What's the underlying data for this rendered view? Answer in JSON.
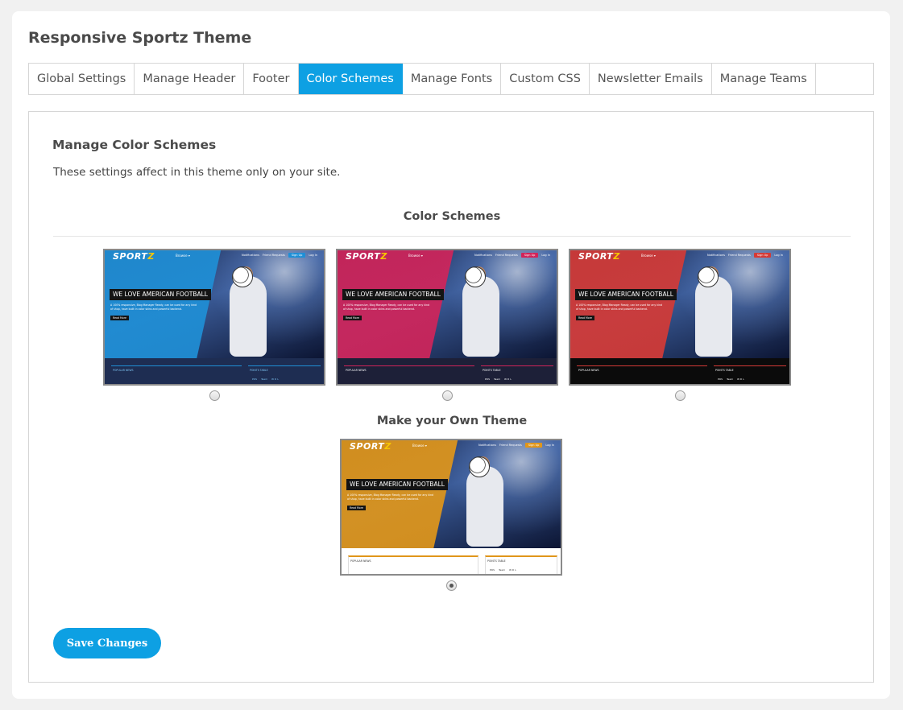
{
  "page": {
    "title": "Responsive Sportz Theme"
  },
  "tabs": [
    {
      "label": "Global Settings",
      "active": false
    },
    {
      "label": "Manage Header",
      "active": false
    },
    {
      "label": "Footer",
      "active": false
    },
    {
      "label": "Color Schemes",
      "active": true
    },
    {
      "label": "Manage Fonts",
      "active": false
    },
    {
      "label": "Custom CSS",
      "active": false
    },
    {
      "label": "Newsletter Emails",
      "active": false
    },
    {
      "label": "Manage Teams",
      "active": false
    }
  ],
  "section": {
    "title": "Manage Color Schemes",
    "description": "These settings affect in this theme only on your site.",
    "schemes_heading": "Color Schemes",
    "own_theme_heading": "Make your Own Theme"
  },
  "preview": {
    "logo_text": "SPORT",
    "logo_accent": "Z",
    "nav_dropdown": "Browse ▾",
    "nav_notifications": "Notifications",
    "nav_friend_requests": "Friend Requests",
    "nav_signup": "Sign Up",
    "nav_login": "Log In",
    "headline": "WE LOVE AMERICAN FOOTBALL",
    "blurb": "A 100% responsive, Blog Manager Ready, can be used for any kind of shop, have built in color skins and powerful backend.",
    "read_more": "Read More",
    "popular_news": "POPULAR NEWS",
    "points_table": "POINTS TABLE",
    "table_pos": "POS",
    "table_team": "Team",
    "table_cols": "W  D  L"
  },
  "schemes": [
    {
      "name": "blue",
      "accent": "#1f8fd6",
      "lower_bg": "#1e2d52",
      "lower_text": "#7fc6f5",
      "line": "#1f8fd6",
      "selected": false
    },
    {
      "name": "pink",
      "accent": "#d0245a",
      "lower_bg": "#1d2038",
      "lower_text": "#ffffff",
      "line": "#d0245a",
      "selected": false
    },
    {
      "name": "red",
      "accent": "#d43a36",
      "lower_bg": "#0b0b0b",
      "lower_text": "#ffffff",
      "line": "#d43a36",
      "selected": false
    }
  ],
  "own_theme": {
    "name": "custom-orange",
    "accent": "#e0961a",
    "lower_bg": "#ffffff",
    "lower_text": "#333333",
    "line": "#e0961a",
    "selected": true
  },
  "actions": {
    "save_label": "Save Changes"
  },
  "colors": {
    "primary": "#0da0e3",
    "tab_active_text": "#ffffff"
  }
}
